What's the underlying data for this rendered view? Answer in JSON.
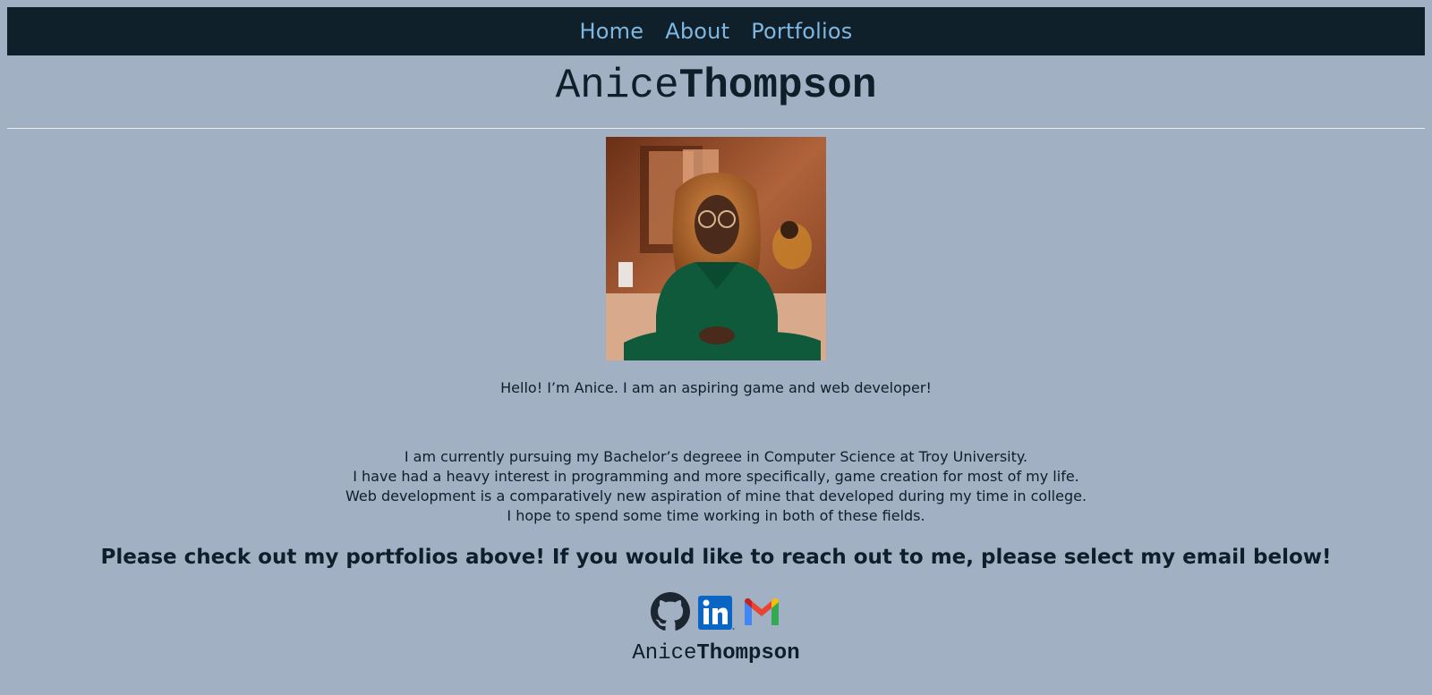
{
  "nav": {
    "links": [
      {
        "label": "Home"
      },
      {
        "label": "About"
      },
      {
        "label": "Portfolios"
      }
    ],
    "link_color": "#7fb7e0",
    "background": "#10202b"
  },
  "header": {
    "first_name": "Anice",
    "last_name": "Thompson"
  },
  "profile_photo": {
    "alt": "Portrait of Anice"
  },
  "intro": "Hello! I’m Anice. I am an aspiring game and web developer!",
  "bio": [
    "I am currently pursuing my Bachelor’s degreee in Computer Science at Troy University.",
    "I have had a heavy interest in programming and more specifically, game creation for most of my life.",
    "Web development is a comparatively new aspiration of mine that developed during my time in college.",
    "I hope to spend some time working in both of these fields."
  ],
  "cta": "Please check out my portfolios above! If you would like to reach out to me, please select my email below!",
  "socials": [
    {
      "icon": "github-icon"
    },
    {
      "icon": "linkedin-icon"
    },
    {
      "icon": "gmail-icon"
    }
  ],
  "footer": {
    "first_name": "Anice",
    "last_name": "Thompson"
  },
  "colors": {
    "page_background": "#a1b0c3",
    "text": "#0f1f2a",
    "linkedin_blue": "#0a66c2"
  }
}
